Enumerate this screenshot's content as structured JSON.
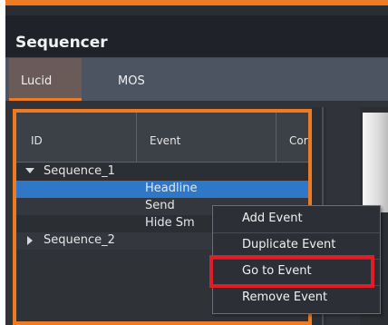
{
  "app": {
    "title": "Sequencer",
    "tabs": [
      {
        "label": "Lucid",
        "active": true
      },
      {
        "label": "MOS",
        "active": false
      }
    ]
  },
  "table": {
    "columns": [
      "ID",
      "Event",
      "Cor"
    ],
    "rows": [
      {
        "id": "Sequence_1",
        "event": "",
        "expanded": true
      },
      {
        "id": "",
        "event": "Headline",
        "selected": true
      },
      {
        "id": "",
        "event": "Send"
      },
      {
        "id": "",
        "event": "Hide Sm"
      },
      {
        "id": "Sequence_2",
        "event": "",
        "expanded": false
      }
    ]
  },
  "context_menu": {
    "items": [
      "Add Event",
      "Duplicate Event",
      "Go to Event",
      "Remove Event"
    ],
    "highlighted": "Go to Event"
  },
  "colors": {
    "accent": "#ee7a21",
    "selection": "#2f78c8",
    "highlight_box": "#e01e2a"
  }
}
